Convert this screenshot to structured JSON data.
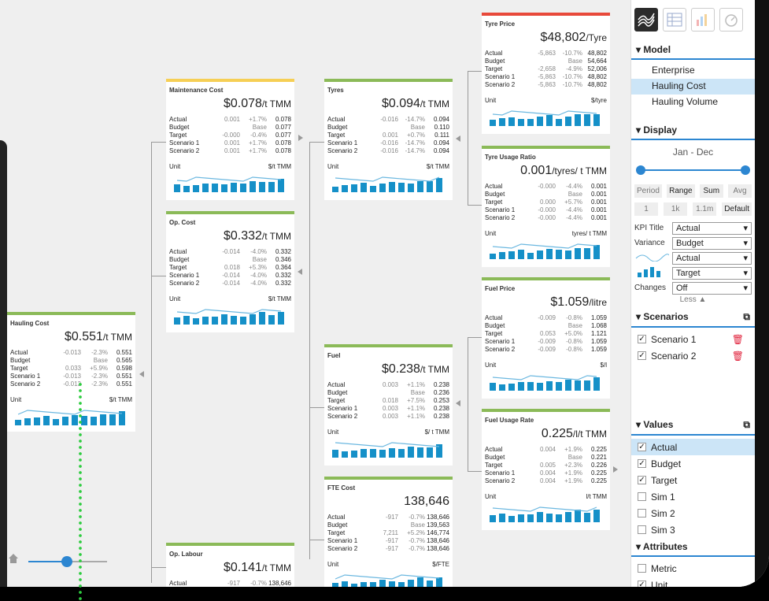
{
  "cards": [
    {
      "id": "hauling-cost",
      "title": "Hauling Cost",
      "value": "$0.551",
      "unit_big": "/t TMM",
      "accent": "#8bba58",
      "rows": [
        [
          "Actual",
          "-0.013",
          "-2.3%",
          "0.551"
        ],
        [
          "Budget",
          "",
          "Base",
          "0.565"
        ],
        [
          "Target",
          "0.033",
          "+5.9%",
          "0.598"
        ],
        [
          "Scenario 1",
          "-0.013",
          "-2.3%",
          "0.551"
        ],
        [
          "Scenario 2",
          "-0.013",
          "-2.3%",
          "0.551"
        ]
      ],
      "unit_label": "Unit",
      "unit_value": "$/t TMM"
    },
    {
      "id": "maintenance-cost",
      "title": "Maintenance Cost",
      "value": "$0.078",
      "unit_big": "/t TMM",
      "accent": "#f6cf55",
      "rows": [
        [
          "Actual",
          "0.001",
          "+1.7%",
          "0.078"
        ],
        [
          "Budget",
          "",
          "Base",
          "0.077"
        ],
        [
          "Target",
          "-0.000",
          "-0.4%",
          "0.077"
        ],
        [
          "Scenario 1",
          "0.001",
          "+1.7%",
          "0.078"
        ],
        [
          "Scenario 2",
          "0.001",
          "+1.7%",
          "0.078"
        ]
      ],
      "unit_label": "Unit",
      "unit_value": "$/t TMM"
    },
    {
      "id": "op-cost",
      "title": "Op. Cost",
      "value": "$0.332",
      "unit_big": "/t TMM",
      "accent": "#8bba58",
      "rows": [
        [
          "Actual",
          "-0.014",
          "-4.0%",
          "0.332"
        ],
        [
          "Budget",
          "",
          "Base",
          "0.346"
        ],
        [
          "Target",
          "0.018",
          "+5.3%",
          "0.364"
        ],
        [
          "Scenario 1",
          "-0.014",
          "-4.0%",
          "0.332"
        ],
        [
          "Scenario 2",
          "-0.014",
          "-4.0%",
          "0.332"
        ]
      ],
      "unit_label": "Unit",
      "unit_value": "$/t TMM"
    },
    {
      "id": "op-labour",
      "title": "Op. Labour",
      "value": "$0.141",
      "unit_big": "/t TMM",
      "accent": "#8bba58",
      "rows": [
        [
          "Actual",
          "-917",
          "-0.7%",
          "138,646"
        ]
      ],
      "unit_label": "",
      "unit_value": ""
    },
    {
      "id": "tyres",
      "title": "Tyres",
      "value": "$0.094",
      "unit_big": "/t TMM",
      "accent": "#8bba58",
      "rows": [
        [
          "Actual",
          "-0.016",
          "-14.7%",
          "0.094"
        ],
        [
          "Budget",
          "",
          "Base",
          "0.110"
        ],
        [
          "Target",
          "0.001",
          "+0.7%",
          "0.111"
        ],
        [
          "Scenario 1",
          "-0.016",
          "-14.7%",
          "0.094"
        ],
        [
          "Scenario 2",
          "-0.016",
          "-14.7%",
          "0.094"
        ]
      ],
      "unit_label": "Unit",
      "unit_value": "$/t TMM"
    },
    {
      "id": "fuel",
      "title": "Fuel",
      "value": "$0.238",
      "unit_big": "/t TMM",
      "accent": "#8bba58",
      "rows": [
        [
          "Actual",
          "0.003",
          "+1.1%",
          "0.238"
        ],
        [
          "Budget",
          "",
          "Base",
          "0.236"
        ],
        [
          "Target",
          "0.018",
          "+7.5%",
          "0.253"
        ],
        [
          "Scenario 1",
          "0.003",
          "+1.1%",
          "0.238"
        ],
        [
          "Scenario 2",
          "0.003",
          "+1.1%",
          "0.238"
        ]
      ],
      "unit_label": "Unit",
      "unit_value": "$/ t TMM"
    },
    {
      "id": "fte-cost",
      "title": "FTE Cost",
      "value": "138,646",
      "unit_big": "",
      "accent": "#8bba58",
      "rows": [
        [
          "Actual",
          "-917",
          "-0.7%",
          "138,646"
        ],
        [
          "Budget",
          "",
          "Base",
          "139,563"
        ],
        [
          "Target",
          "7,211",
          "+5.2%",
          "146,774"
        ],
        [
          "Scenario 1",
          "-917",
          "-0.7%",
          "138,646"
        ],
        [
          "Scenario 2",
          "-917",
          "-0.7%",
          "138,646"
        ]
      ],
      "unit_label": "Unit",
      "unit_value": "$/FTE"
    },
    {
      "id": "tyre-price",
      "title": "Tyre Price",
      "value": "$48,802",
      "unit_big": "/Tyre",
      "accent": "#e8493a",
      "rows": [
        [
          "Actual",
          "-5,863",
          "-10.7%",
          "48,802"
        ],
        [
          "Budget",
          "",
          "Base",
          "54,664"
        ],
        [
          "Target",
          "-2,658",
          "-4.9%",
          "52,006"
        ],
        [
          "Scenario 1",
          "-5,863",
          "-10.7%",
          "48,802"
        ],
        [
          "Scenario 2",
          "-5,863",
          "-10.7%",
          "48,802"
        ]
      ],
      "unit_label": "Unit",
      "unit_value": "$/tyre"
    },
    {
      "id": "tyre-usage-ratio",
      "title": "Tyre Usage Ratio",
      "value": "0.001",
      "unit_big": "/tyres/ t TMM",
      "accent": "#8bba58",
      "rows": [
        [
          "Actual",
          "-0.000",
          "-4.4%",
          "0.001"
        ],
        [
          "Budget",
          "",
          "Base",
          "0.001"
        ],
        [
          "Target",
          "0.000",
          "+5.7%",
          "0.001"
        ],
        [
          "Scenario 1",
          "-0.000",
          "-4.4%",
          "0.001"
        ],
        [
          "Scenario 2",
          "-0.000",
          "-4.4%",
          "0.001"
        ]
      ],
      "unit_label": "Unit",
      "unit_value": "tyres/ t TMM"
    },
    {
      "id": "fuel-price",
      "title": "Fuel Price",
      "value": "$1.059",
      "unit_big": "/litre",
      "accent": "#8bba58",
      "rows": [
        [
          "Actual",
          "-0.009",
          "-0.8%",
          "1.059"
        ],
        [
          "Budget",
          "",
          "Base",
          "1.068"
        ],
        [
          "Target",
          "0.053",
          "+5.0%",
          "1.121"
        ],
        [
          "Scenario 1",
          "-0.009",
          "-0.8%",
          "1.059"
        ],
        [
          "Scenario 2",
          "-0.009",
          "-0.8%",
          "1.059"
        ]
      ],
      "unit_label": "Unit",
      "unit_value": "$/l"
    },
    {
      "id": "fuel-usage-rate",
      "title": "Fuel Usage Rate",
      "value": "0.225",
      "unit_big": "/l/t TMM",
      "accent": "#8bba58",
      "rows": [
        [
          "Actual",
          "0.004",
          "+1.9%",
          "0.225"
        ],
        [
          "Budget",
          "",
          "Base",
          "0.221"
        ],
        [
          "Target",
          "0.005",
          "+2.3%",
          "0.226"
        ],
        [
          "Scenario 1",
          "0.004",
          "+1.9%",
          "0.225"
        ],
        [
          "Scenario 2",
          "0.004",
          "+1.9%",
          "0.225"
        ]
      ],
      "unit_label": "Unit",
      "unit_value": "l/t TMM"
    }
  ],
  "panel": {
    "model_title": "Model",
    "model_items": [
      "Enterprise",
      "Hauling Cost",
      "Hauling Volume"
    ],
    "model_selected": 1,
    "display_title": "Display",
    "display_range": "Jan - Dec",
    "agg_buttons": [
      "Period",
      "Range",
      "Sum",
      "Avg"
    ],
    "scale_buttons": [
      "1",
      "1k",
      "1.1m",
      "Default"
    ],
    "fields": [
      [
        "KPI Title",
        "Actual"
      ],
      [
        "Variance",
        "Budget"
      ],
      [
        "",
        "Actual"
      ],
      [
        "",
        "Target"
      ],
      [
        "Changes",
        "Off"
      ]
    ],
    "less": "Less ▲",
    "scenarios_title": "Scenarios",
    "scenarios": [
      "Scenario 1",
      "Scenario 2"
    ],
    "values_title": "Values",
    "values": [
      [
        "Actual",
        true
      ],
      [
        "Budget",
        true
      ],
      [
        "Target",
        true
      ],
      [
        "Sim 1",
        false
      ],
      [
        "Sim 2",
        false
      ],
      [
        "Sim 3",
        false
      ]
    ],
    "attributes_title": "Attributes",
    "attributes": [
      [
        "Metric",
        false
      ],
      [
        "Unit",
        true
      ]
    ]
  },
  "colors": {
    "accent": "#2c86d1",
    "bar": "#1590c8",
    "ok": "#8bba58",
    "warn": "#f6cf55",
    "bad": "#e8493a"
  }
}
